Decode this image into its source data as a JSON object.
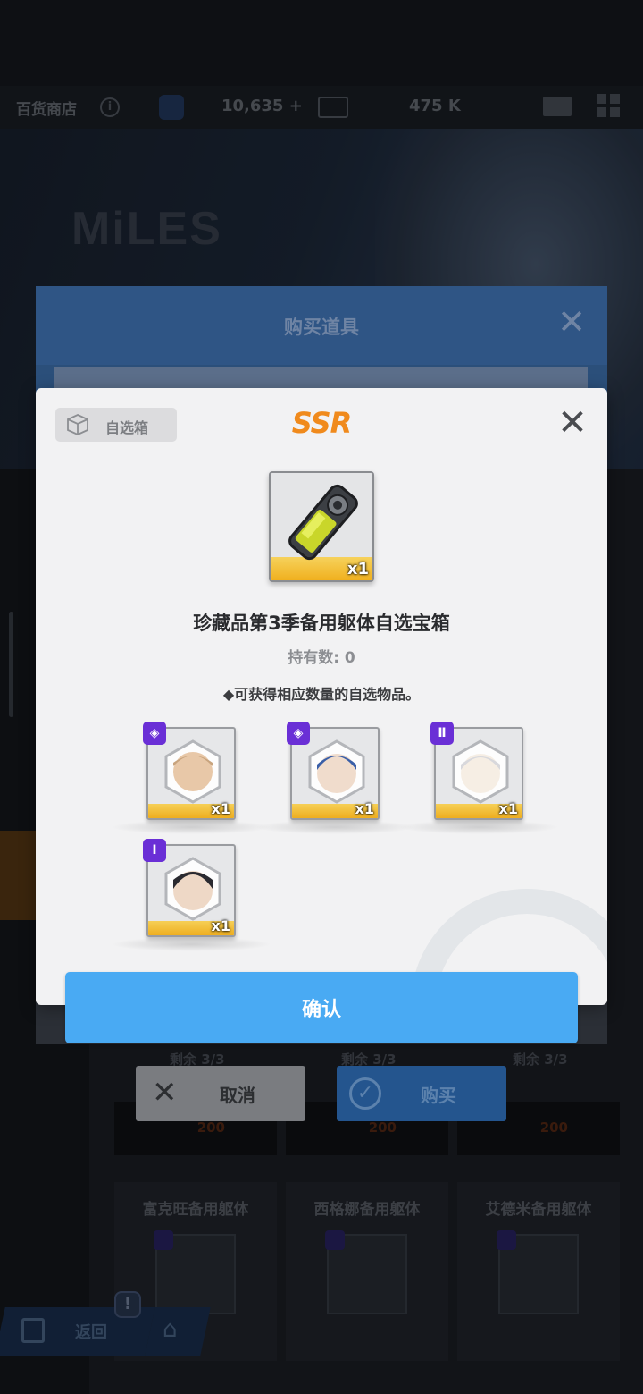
{
  "topbar": {
    "shop_name": "百货商店",
    "info_icon": "info-icon",
    "currency1_value": "10,635 +",
    "currency2_value": "475 K",
    "mail_icon": "mail-icon",
    "menu_icon": "grid-menu-icon"
  },
  "banner": {
    "brand": "MiLES"
  },
  "background_shop": {
    "remaining": [
      "剩余 3/3",
      "剩余 3/3",
      "剩余 3/3"
    ],
    "prices": [
      "200",
      "200",
      "200"
    ],
    "items": [
      "富克旺备用躯体",
      "西格娜备用躯体",
      "艾德米备用躯体"
    ],
    "return_label": "返回",
    "notification": "!"
  },
  "buy_dialog": {
    "title": "购买道具",
    "cancel_label": "取消",
    "buy_label": "购买"
  },
  "modal": {
    "tag_label": "自选箱",
    "rarity": "SSR",
    "item_qty": "x1",
    "item_name": "珍藏品第3季备用躯体自选宝箱",
    "owned": "持有数: 0",
    "description": "◆可获得相应数量的自选物品。",
    "rewards": [
      {
        "qty": "x1",
        "badge": "◈"
      },
      {
        "qty": "x1",
        "badge": "◈"
      },
      {
        "qty": "x1",
        "badge": "Ⅱ"
      },
      {
        "qty": "x1",
        "badge": "Ⅰ"
      }
    ],
    "confirm_label": "确认"
  },
  "colors": {
    "rarity": "#f08a1c",
    "confirm": "#49aaf3",
    "badge": "#6a2fd6",
    "item_stripe": "#f0b01e"
  }
}
